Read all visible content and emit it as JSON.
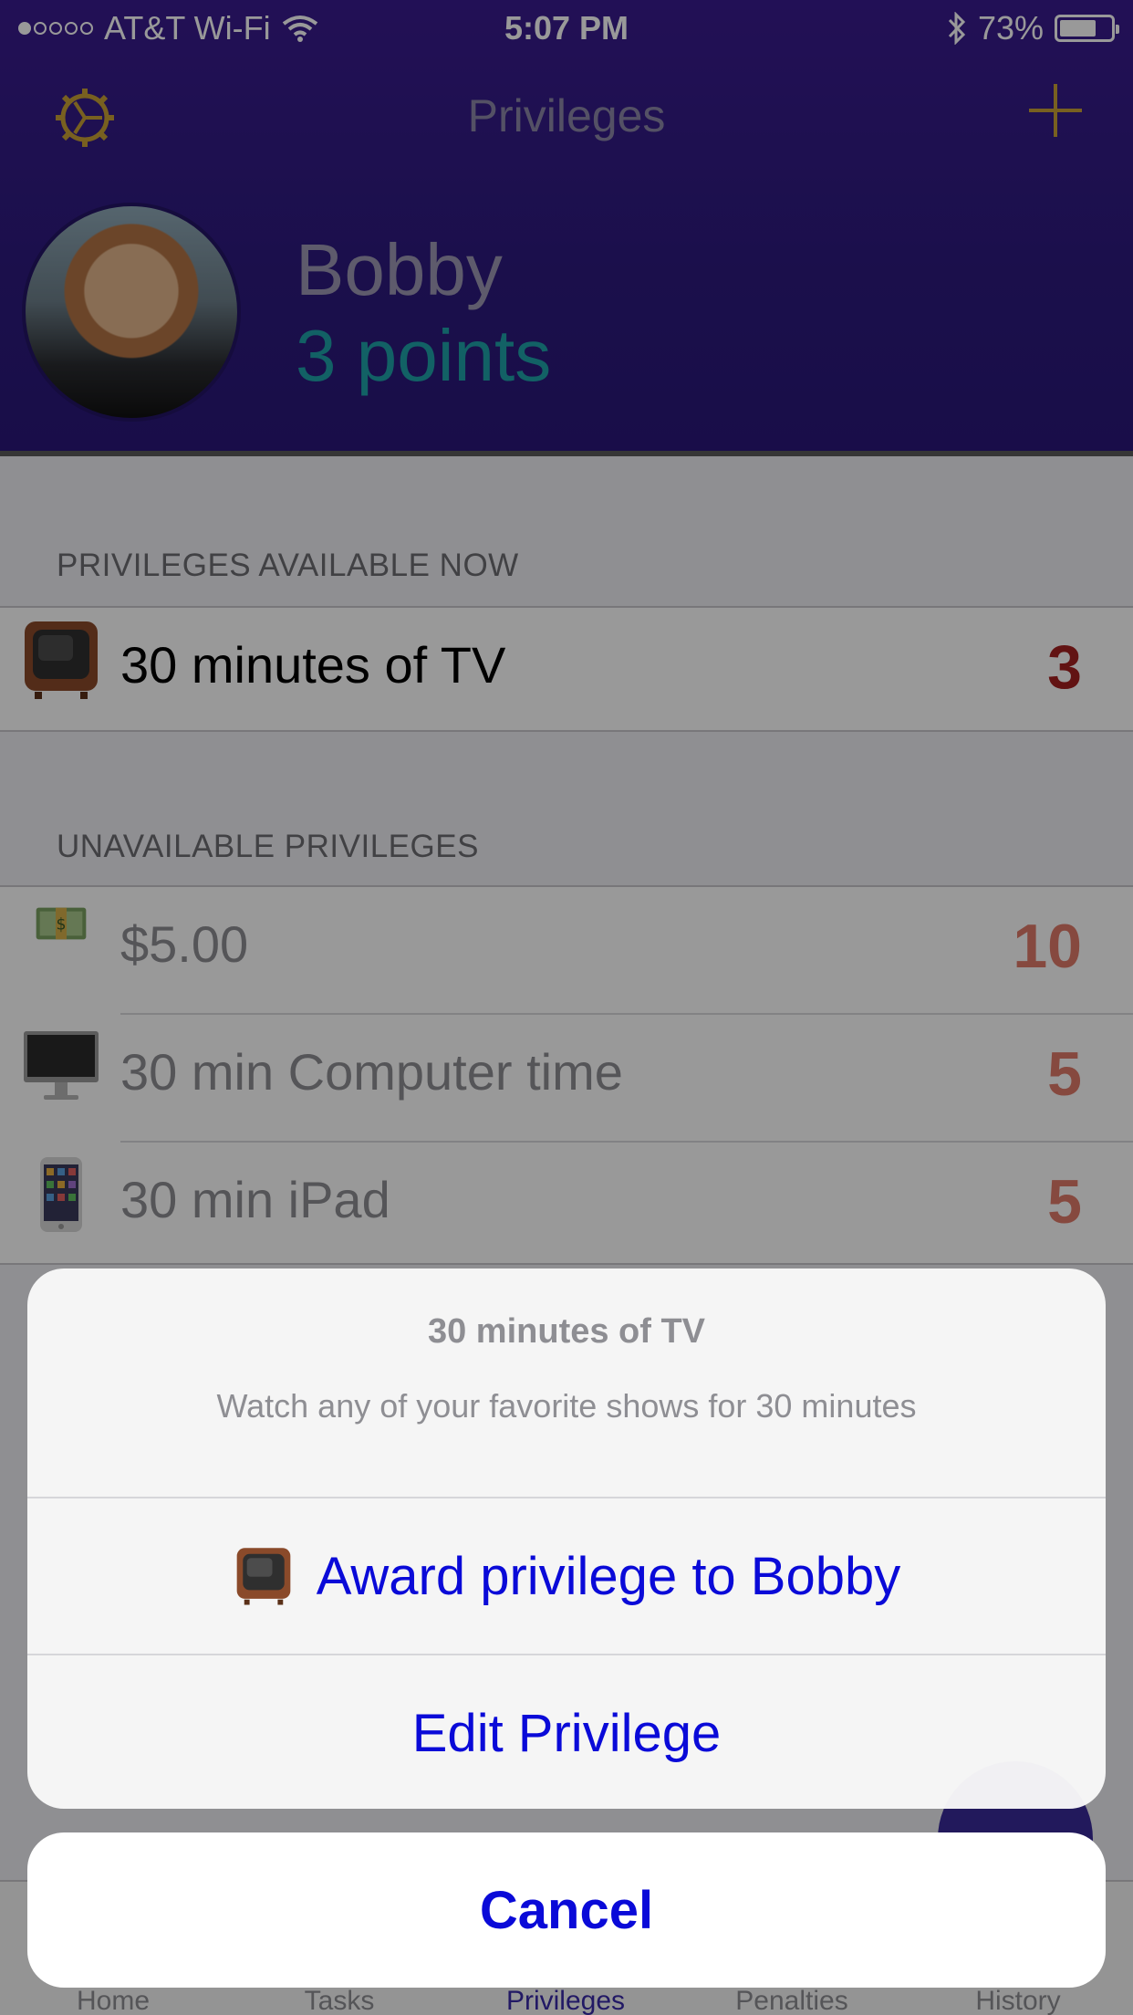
{
  "status_bar": {
    "carrier": "AT&T Wi-Fi",
    "time": "5:07 PM",
    "battery": "73%",
    "battery_level": 0.73
  },
  "nav": {
    "title": "Privileges",
    "settings_icon": "gear-icon",
    "add_icon": "plus-icon"
  },
  "profile": {
    "name": "Bobby",
    "points": "3 points"
  },
  "sections": {
    "available_header": "PRIVILEGES AVAILABLE NOW",
    "unavailable_header": "UNAVAILABLE PRIVILEGES"
  },
  "available": [
    {
      "icon": "tv-icon",
      "label": "30 minutes of TV",
      "cost": "3"
    }
  ],
  "unavailable": [
    {
      "icon": "money-icon",
      "label": "$5.00",
      "cost": "10"
    },
    {
      "icon": "computer-icon",
      "label": "30 min Computer time",
      "cost": "5"
    },
    {
      "icon": "ipad-icon",
      "label": "30 min iPad",
      "cost": "5"
    }
  ],
  "tabs": [
    {
      "label": "Home"
    },
    {
      "label": "Tasks"
    },
    {
      "label": "Privileges",
      "active": true
    },
    {
      "label": "Penalties"
    },
    {
      "label": "History"
    }
  ],
  "sheet": {
    "title": "30 minutes of TV",
    "message": "Watch any of your favorite shows for 30 minutes",
    "award_label": "Award privilege to Bobby",
    "edit_label": "Edit Privilege",
    "cancel_label": "Cancel"
  },
  "colors": {
    "header_bg": "#2d1a7e",
    "accent_gold": "#c8a036",
    "points_teal": "#1ea2a8",
    "cost_red": "#a42020",
    "action_blue": "#0a0ad8"
  }
}
